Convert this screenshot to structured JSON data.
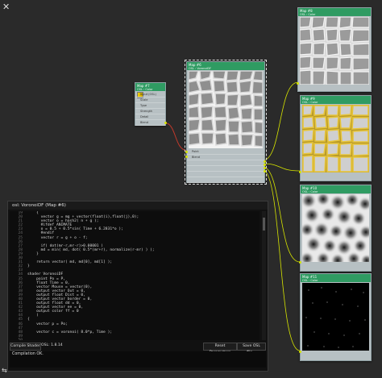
{
  "window": {
    "close_glyph": "✕"
  },
  "nodes": {
    "map07": {
      "title": "Map #7",
      "subtitle": "OSL : Color",
      "rows": [
        "Input (OSL)",
        "Scale",
        "Type",
        "Strength",
        "Detail",
        "Blend",
        "Randomize",
        "Random Offset",
        "Randomize Offset"
      ]
    },
    "map06": {
      "title": "Map #6",
      "subtitle": "OSL : VoronoiDF",
      "rows": [
        "Point",
        "Blend"
      ]
    },
    "outA": {
      "title": "Map #8",
      "subtitle": "OSL : Color"
    },
    "outB": {
      "title": "Map #9",
      "subtitle": "OSL : Color"
    },
    "outC": {
      "title": "Map #10",
      "subtitle": "OSL : Color"
    },
    "outD": {
      "title": "Map #11",
      "subtitle": "OSL : Color"
    }
  },
  "editor": {
    "title": "osl: VoronoiDF (Map #6)",
    "line_numbers": [
      "19",
      "20",
      "21",
      "22",
      "23",
      "24",
      "25",
      "26",
      "27",
      "28",
      "29",
      "30",
      "31",
      "32",
      "33",
      "34",
      "35",
      "36",
      "37",
      "38",
      "39",
      "40",
      "41",
      "42",
      "43",
      "44",
      "45",
      "46",
      "47",
      "48",
      "49",
      "50",
      "51"
    ],
    "lines": [
      "    {",
      "      vector g = mg + vector(float(i),float(j),0);",
      "      vector o = hash2( n + g );",
      "      #ifdef ANIMATE",
      "      o = 0.5 + 0.5*sin( Time + 6.2831*o );",
      "      #endif",
      "      vector r = g + o - f;",
      "",
      "      if( dot(mr-r,mr-r)>0.00001 )",
      "      md = min( md, dot( 0.5*(mr+r), normalize(r-mr) ) );",
      "    }",
      "",
      "    return vector( md, md[0], md[1] );",
      "}",
      "",
      "shader VoronoiDF",
      "    point Po = P,",
      "    float Time = 0,",
      "    vector Mouse = vector(0),",
      "    output vector Out = 0,",
      "    output float Dist = 0,",
      "    output vector border = 0,",
      "    output float dd = 0,",
      "    output vector ee = 0,",
      "    output color ff = 0",
      "    )",
      "{",
      "    vector p = Po;",
      "",
      "    vector c = voronoi( 8.0*p, Time );",
      "    ",
      "    ",
      "    "
    ],
    "compile_label": "Compile Shader",
    "version_label": "OSL: 1.8.14",
    "reset_label": "Reset Parameters",
    "save_label": "Save OSL file...",
    "output_text": "Compilation OK."
  },
  "colors": {
    "node_header": "#2f9b62",
    "socket": "#d6e400",
    "wire_red": "#c0392b",
    "wire_yellow": "#d6e400"
  }
}
